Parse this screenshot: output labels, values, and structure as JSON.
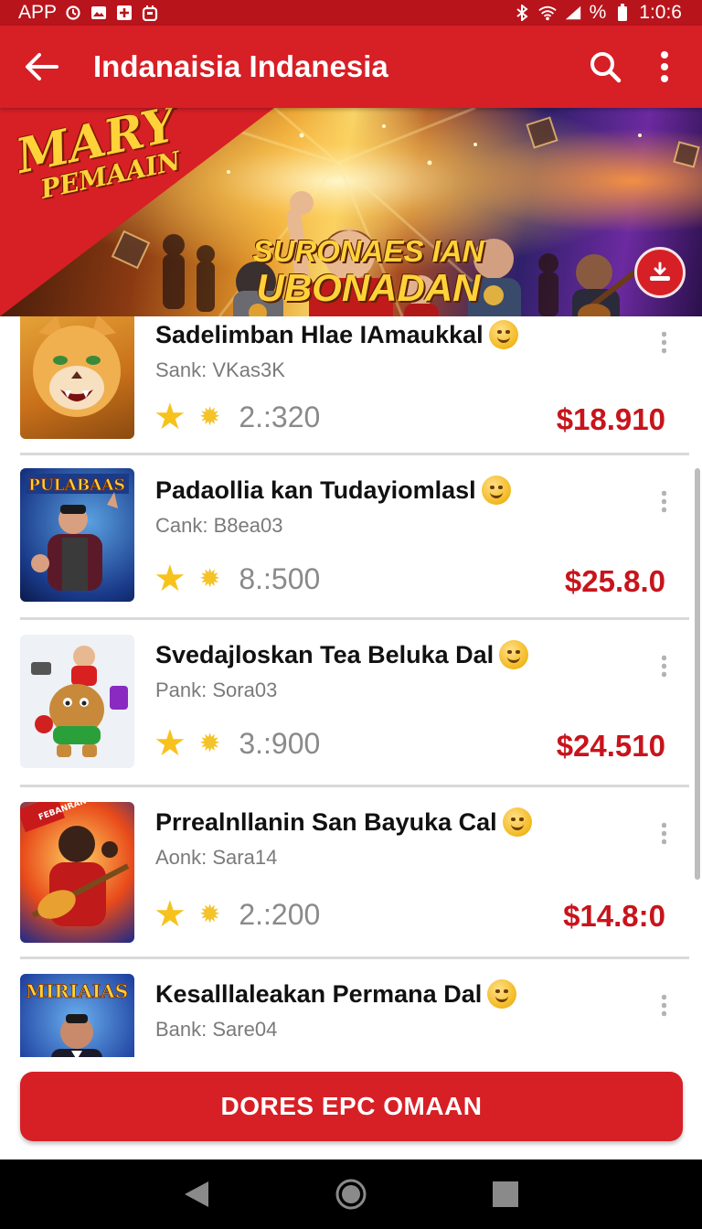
{
  "status_bar": {
    "left_text": "APP",
    "left_icons": [
      "sync-icon",
      "image-icon",
      "plus-icon",
      "android-icon"
    ],
    "right_icons": [
      "bluetooth-icon",
      "wifi-icon",
      "signal-icon"
    ],
    "battery_text": "%",
    "time": "1:0:6"
  },
  "app_bar": {
    "title": "Indanaisia Indanesia",
    "back_icon": "arrow-left-icon",
    "search_icon": "search-icon",
    "more_icon": "more-vertical-icon"
  },
  "banner": {
    "corner_big": "MARY",
    "corner_small": "PEMAAIN",
    "title_line1": "SURONAES IAN",
    "title_line2": "UBONADAN",
    "fab_icon": "download-icon"
  },
  "items": [
    {
      "title": "Sadelimban Hlae IAmaukkal",
      "subtitle": "Sank: VKas3K",
      "score": "2.:320",
      "price": "$18.910"
    },
    {
      "title": "Padaollia kan Tudayiomlasl",
      "subtitle": "Cank: B8ea03",
      "score": "8.:500",
      "price": "$25.8.0",
      "thumb_text": "PULABAAS"
    },
    {
      "title": "Svedajloskan Tea Beluka Dal",
      "subtitle": "Pank: Sora03",
      "score": "3.:900",
      "price": "$24.510"
    },
    {
      "title": "Prrealnllanin San Bayuka Cal",
      "subtitle": "Aonk: Sara14",
      "score": "2.:200",
      "price": "$14.8:0",
      "thumb_text": "FEBANRAN"
    },
    {
      "title": "Kesalllaleakan  Permana Dal",
      "subtitle": "Bank: Sare04",
      "thumb_text": "MIRIAIAS"
    }
  ],
  "cta": {
    "label": "DORES EPC OMAAN"
  },
  "nav": {
    "back": "nav-back-icon",
    "home": "nav-home-icon",
    "recents": "nav-recents-icon"
  },
  "colors": {
    "primary": "#d71f26",
    "status_bar": "#b8141c",
    "price": "#c8141c",
    "star": "#f7c21c"
  }
}
